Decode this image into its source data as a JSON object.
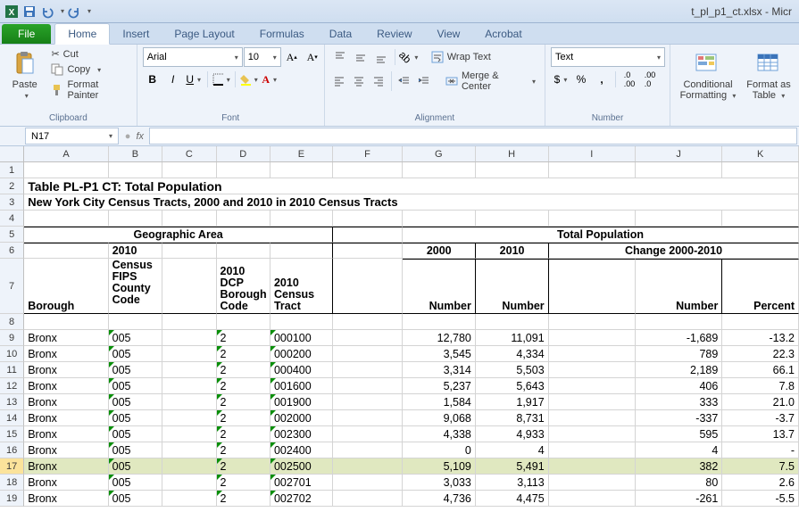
{
  "window": {
    "title": "t_pl_p1_ct.xlsx - Micr"
  },
  "tabs": {
    "file": "File",
    "home": "Home",
    "insert": "Insert",
    "pagelayout": "Page Layout",
    "formulas": "Formulas",
    "data": "Data",
    "review": "Review",
    "view": "View",
    "acrobat": "Acrobat"
  },
  "ribbon": {
    "clipboard": {
      "paste": "Paste",
      "cut": "Cut",
      "copy": "Copy",
      "painter": "Format Painter",
      "label": "Clipboard"
    },
    "font": {
      "name": "Arial",
      "size": "10",
      "label": "Font"
    },
    "alignment": {
      "wrap": "Wrap Text",
      "merge": "Merge & Center",
      "label": "Alignment"
    },
    "number": {
      "fmt": "Text",
      "label": "Number"
    },
    "styles": {
      "cond": "Conditional Formatting",
      "fat": "Format as Table"
    }
  },
  "namebox": "N17",
  "cols": [
    "A",
    "B",
    "C",
    "D",
    "E",
    "F",
    "G",
    "H",
    "I",
    "J",
    "K"
  ],
  "title": "Table PL-P1 CT:  Total Population",
  "subtitle": "New York City Census Tracts, 2000 and 2010 in 2010 Census Tracts",
  "hdr": {
    "geo": "Geographic Area",
    "totpop": "Total Population",
    "borough": "Borough",
    "fips": "2010 Census FIPS County Code",
    "dcp": "2010 DCP Borough Code",
    "tract": "2010 Census Tract",
    "y2000": "2000",
    "y2010": "2010",
    "change": "Change 2000-2010",
    "number": "Number",
    "percent": "Percent"
  },
  "rows": [
    {
      "b": "Bronx",
      "f": "005",
      "d": "2",
      "t": "000100",
      "n0": "12,780",
      "n1": "11,091",
      "cn": "-1,689",
      "cp": "-13.2"
    },
    {
      "b": "Bronx",
      "f": "005",
      "d": "2",
      "t": "000200",
      "n0": "3,545",
      "n1": "4,334",
      "cn": "789",
      "cp": "22.3"
    },
    {
      "b": "Bronx",
      "f": "005",
      "d": "2",
      "t": "000400",
      "n0": "3,314",
      "n1": "5,503",
      "cn": "2,189",
      "cp": "66.1"
    },
    {
      "b": "Bronx",
      "f": "005",
      "d": "2",
      "t": "001600",
      "n0": "5,237",
      "n1": "5,643",
      "cn": "406",
      "cp": "7.8"
    },
    {
      "b": "Bronx",
      "f": "005",
      "d": "2",
      "t": "001900",
      "n0": "1,584",
      "n1": "1,917",
      "cn": "333",
      "cp": "21.0"
    },
    {
      "b": "Bronx",
      "f": "005",
      "d": "2",
      "t": "002000",
      "n0": "9,068",
      "n1": "8,731",
      "cn": "-337",
      "cp": "-3.7"
    },
    {
      "b": "Bronx",
      "f": "005",
      "d": "2",
      "t": "002300",
      "n0": "4,338",
      "n1": "4,933",
      "cn": "595",
      "cp": "13.7"
    },
    {
      "b": "Bronx",
      "f": "005",
      "d": "2",
      "t": "002400",
      "n0": "0",
      "n1": "4",
      "cn": "4",
      "cp": "-"
    },
    {
      "b": "Bronx",
      "f": "005",
      "d": "2",
      "t": "002500",
      "n0": "5,109",
      "n1": "5,491",
      "cn": "382",
      "cp": "7.5"
    },
    {
      "b": "Bronx",
      "f": "005",
      "d": "2",
      "t": "002701",
      "n0": "3,033",
      "n1": "3,113",
      "cn": "80",
      "cp": "2.6"
    },
    {
      "b": "Bronx",
      "f": "005",
      "d": "2",
      "t": "002702",
      "n0": "4,736",
      "n1": "4,475",
      "cn": "-261",
      "cp": "-5.5"
    }
  ],
  "selrow": 17
}
